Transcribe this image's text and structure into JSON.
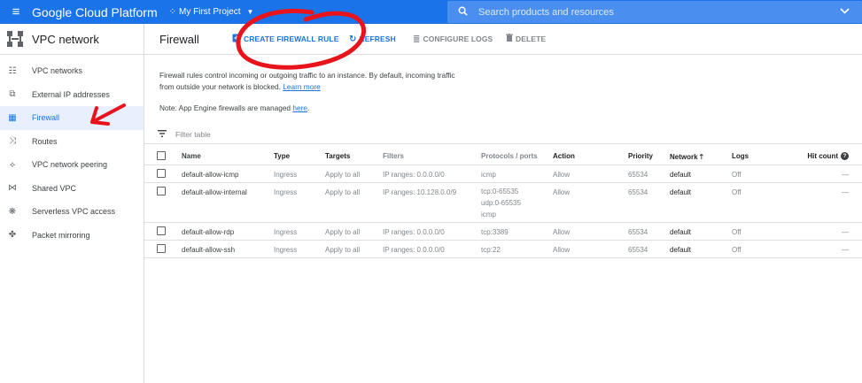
{
  "topbar": {
    "brand": "Google Cloud Platform",
    "project": "My First Project",
    "search_placeholder": "Search products and resources"
  },
  "sidebar": {
    "title": "VPC network",
    "items": [
      {
        "label": "VPC networks",
        "icon": "vpc-networks-icon"
      },
      {
        "label": "External IP addresses",
        "icon": "external-ip-icon"
      },
      {
        "label": "Firewall",
        "icon": "firewall-icon",
        "active": true
      },
      {
        "label": "Routes",
        "icon": "routes-icon"
      },
      {
        "label": "VPC network peering",
        "icon": "peering-icon"
      },
      {
        "label": "Shared VPC",
        "icon": "shared-vpc-icon"
      },
      {
        "label": "Serverless VPC access",
        "icon": "serverless-icon"
      },
      {
        "label": "Packet mirroring",
        "icon": "packet-mirroring-icon"
      }
    ]
  },
  "header": {
    "title": "Firewall",
    "create": "CREATE FIREWALL RULE",
    "refresh": "REFRESH",
    "configure": "CONFIGURE LOGS",
    "delete": "DELETE"
  },
  "info": {
    "text": "Firewall rules control incoming or outgoing traffic to an instance. By default, incoming traffic from outside your network is blocked.",
    "learn_more": "Learn more",
    "note_prefix": "Note: App Engine firewalls are managed",
    "note_link": "here",
    "note_suffix": "."
  },
  "filter": {
    "placeholder": "Filter table"
  },
  "table": {
    "headers": {
      "name": "Name",
      "type": "Type",
      "targets": "Targets",
      "filters": "Filters",
      "protocols": "Protocols / ports",
      "action": "Action",
      "priority": "Priority",
      "network": "Network",
      "logs": "Logs",
      "hit_count": "Hit count"
    },
    "rows": [
      {
        "name": "default-allow-icmp",
        "type": "Ingress",
        "targets": "Apply to all",
        "filters": "IP ranges: 0.0.0.0/0",
        "protocols": [
          "icmp"
        ],
        "action": "Allow",
        "priority": "65534",
        "network": "default",
        "logs": "Off",
        "hit": "—"
      },
      {
        "name": "default-allow-internal",
        "type": "Ingress",
        "targets": "Apply to all",
        "filters": "IP ranges: 10.128.0.0/9",
        "protocols": [
          "tcp:0-65535",
          "udp:0-65535",
          "icmp"
        ],
        "action": "Allow",
        "priority": "65534",
        "network": "default",
        "logs": "Off",
        "hit": "—"
      },
      {
        "name": "default-allow-rdp",
        "type": "Ingress",
        "targets": "Apply to all",
        "filters": "IP ranges: 0.0.0.0/0",
        "protocols": [
          "tcp:3389"
        ],
        "action": "Allow",
        "priority": "65534",
        "network": "default",
        "logs": "Off",
        "hit": "—"
      },
      {
        "name": "default-allow-ssh",
        "type": "Ingress",
        "targets": "Apply to all",
        "filters": "IP ranges: 0.0.0.0/0",
        "protocols": [
          "tcp:22"
        ],
        "action": "Allow",
        "priority": "65534",
        "network": "default",
        "logs": "Off",
        "hit": "—"
      }
    ]
  },
  "colors": {
    "brand_blue": "#1a73e8",
    "annotation_red": "#e8131b"
  }
}
